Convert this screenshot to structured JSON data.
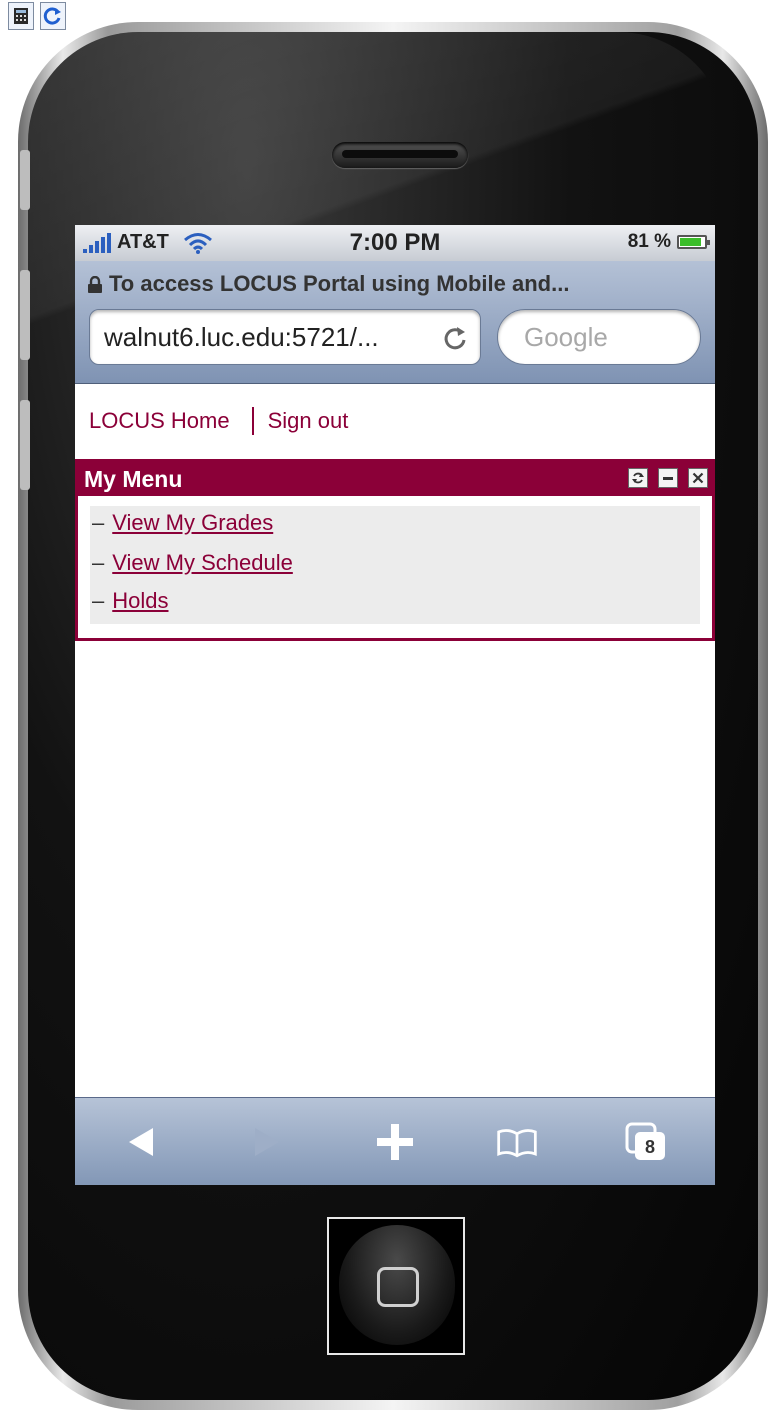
{
  "emulator": {
    "icons": [
      "calculator-icon",
      "refresh-icon"
    ]
  },
  "statusbar": {
    "carrier": "AT&T",
    "time": "7:00 PM",
    "battery": "81 %",
    "battery_level": 0.81
  },
  "safari": {
    "page_title": "To access LOCUS Portal using Mobile and...",
    "url": "walnut6.luc.edu:5721/...",
    "search_placeholder": "Google"
  },
  "top_nav": {
    "home_link": "LOCUS Home",
    "signout_link": "Sign out"
  },
  "my_menu": {
    "title": "My Menu",
    "header_icons": [
      "refresh-icon",
      "minimize-icon",
      "close-icon"
    ],
    "items": [
      {
        "label": "View My Grades"
      },
      {
        "label": "View My Schedule"
      },
      {
        "label": "Holds"
      }
    ]
  },
  "toolbar": {
    "tabs_count": "8",
    "icons": [
      "back-icon",
      "forward-icon",
      "add-icon",
      "bookmarks-icon",
      "tabs-icon"
    ]
  },
  "colors": {
    "brand": "#8b0038",
    "safari_bar": "#9aabc6"
  }
}
